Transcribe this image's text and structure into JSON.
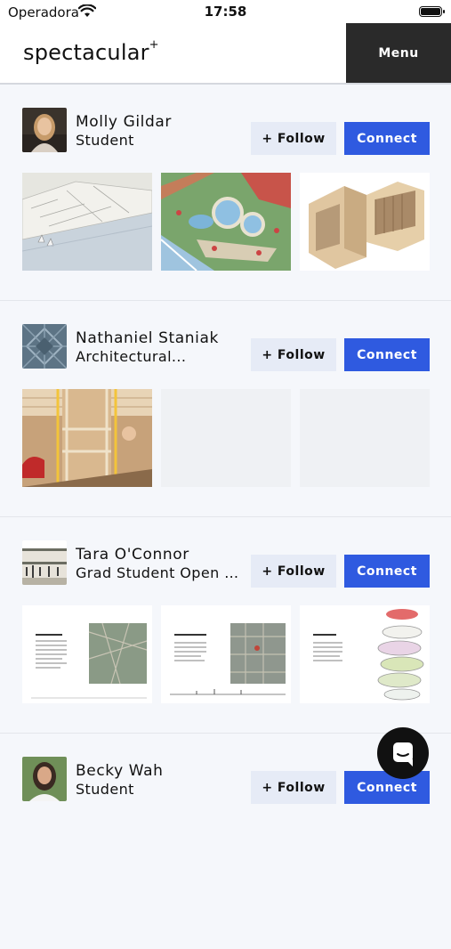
{
  "status_bar": {
    "carrier": "Operadora",
    "time": "17:58"
  },
  "header": {
    "brand": "spectacular",
    "brand_mark": "+",
    "menu_label": "Menu"
  },
  "buttons": {
    "follow_label": "+ Follow",
    "connect_label": "Connect"
  },
  "profiles": [
    {
      "name": "Molly Gildar",
      "role": "Student"
    },
    {
      "name": "Nathaniel Staniak",
      "role": "Architectural..."
    },
    {
      "name": "Tara O'Connor",
      "role": "Grad Student Open t..."
    },
    {
      "name": "Becky Wah",
      "role": "Student"
    }
  ],
  "colors": {
    "connect": "#2f5ae0",
    "follow": "#e6ebf6",
    "menu": "#2a2a2a",
    "background": "#f5f7fb"
  },
  "icons": {
    "status": [
      "wifi-icon",
      "battery-icon"
    ],
    "chat": "chat-icon"
  }
}
